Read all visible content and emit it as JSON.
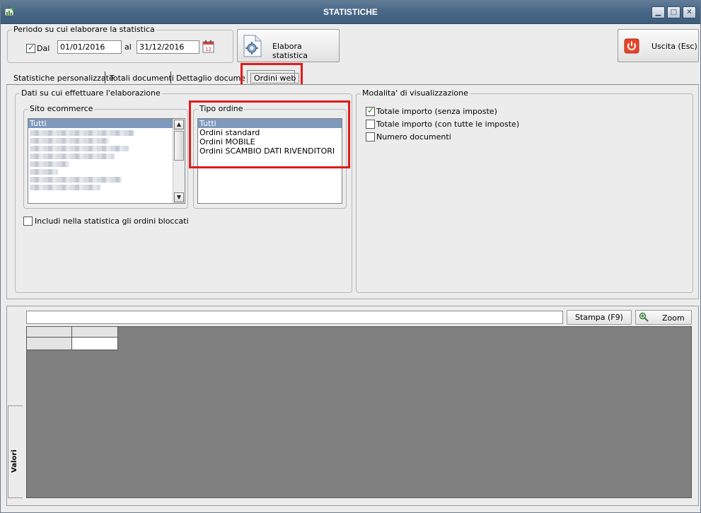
{
  "window": {
    "title": "STATISTICHE"
  },
  "period": {
    "legend": "Periodo su cui elaborare la statistica",
    "dal_label": "Dal",
    "dal_checked": true,
    "from_date": "01/01/2016",
    "al_label": "al",
    "to_date": "31/12/2016"
  },
  "toolbar": {
    "elabora_label": "Elabora statistica",
    "uscita_label": "Uscita (Esc)"
  },
  "tabs": [
    {
      "label": "Statistiche personalizzate",
      "active": false
    },
    {
      "label": "Totali documenti",
      "active": false
    },
    {
      "label": "Dettaglio documen",
      "active": false
    },
    {
      "label": "Ordini web",
      "active": true
    }
  ],
  "data_group": {
    "legend": "Dati su cui effettuare l'elaborazione",
    "sito": {
      "legend": "Sito ecommerce",
      "items": [
        "Tutti"
      ],
      "selected": "Tutti"
    },
    "tipo": {
      "legend": "Tipo ordine",
      "items": [
        "Tutti",
        "Ordini standard",
        "Ordini MOBILE",
        "Ordini SCAMBIO DATI RIVENDITORI"
      ],
      "selected": "Tutti"
    },
    "include_blocked_label": "Includi nella statistica gli ordini bloccati",
    "include_blocked_checked": false
  },
  "display_group": {
    "legend": "Modalita' di visualizzazione",
    "options": [
      {
        "label": "Totale importo (senza imposte)",
        "checked": true
      },
      {
        "label": "Totale importo (con tutte le imposte)",
        "checked": false
      },
      {
        "label": "Numero documenti",
        "checked": false
      }
    ]
  },
  "bottom": {
    "stampa_label": "Stampa (F9)",
    "zoom_label": "Zoom",
    "side_tab_label": "Valori"
  },
  "colors": {
    "titlebar": "#4a6887",
    "highlight": "#e01b1b",
    "selection": "#7f99bd",
    "grid_bg": "#808080"
  }
}
